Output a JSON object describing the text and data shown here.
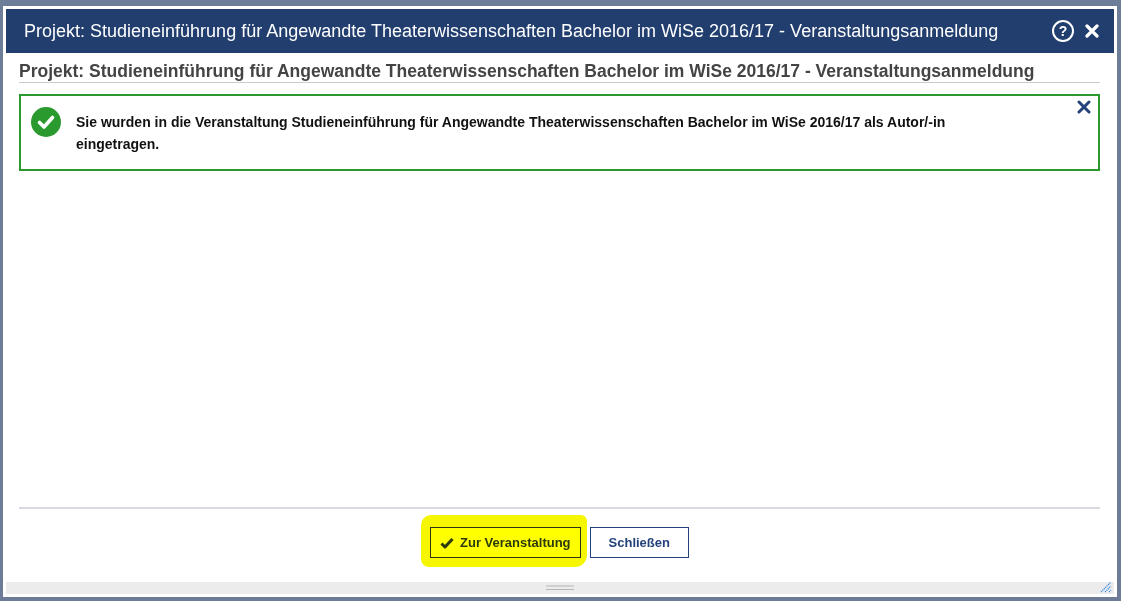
{
  "window": {
    "title": "Projekt: Studieneinführung für Angewandte Theaterwissenschaften Bachelor im WiSe 2016/17 - Veranstaltungsanmeldung",
    "help": "?"
  },
  "heading": "Projekt: Studieneinführung für Angewandte Theaterwissenschaften Bachelor im WiSe 2016/17 - Veranstaltungsanmeldung",
  "message": {
    "kind": "success",
    "text": "Sie wurden in die Veranstaltung Studieneinführung für Angewandte Theaterwissenschaften Bachelor im WiSe 2016/17 als Autor/-in eingetragen."
  },
  "buttons": [
    {
      "label": "Zur Veranstaltung",
      "kind": "confirm",
      "highlighted": true
    },
    {
      "label": "Schließen",
      "kind": "plain",
      "highlighted": false
    }
  ]
}
